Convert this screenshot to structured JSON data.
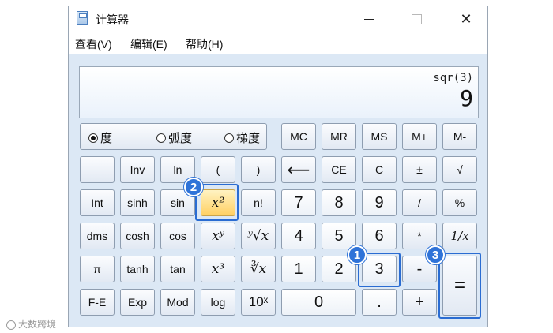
{
  "window": {
    "title": "计算器",
    "minimize": "—",
    "maximize": "□",
    "close": "✕"
  },
  "menu": [
    "查看(V)",
    "编辑(E)",
    "帮助(H)"
  ],
  "display": {
    "expression": "sqr(3)",
    "result": "9"
  },
  "angle_modes": {
    "selected": "度",
    "options": [
      "度",
      "弧度",
      "梯度"
    ]
  },
  "buttons": {
    "mc": "MC",
    "mr": "MR",
    "ms": "MS",
    "mplus": "M+",
    "mminus": "M-",
    "inv": "Inv",
    "ln": "ln",
    "lparen": "(",
    "rparen": ")",
    "backspace": "⟵",
    "ce": "CE",
    "c": "C",
    "plusminus": "±",
    "sqrt": "√",
    "int": "Int",
    "sinh": "sinh",
    "sin": "sin",
    "square": "x²",
    "factorial": "n!",
    "n7": "7",
    "n8": "8",
    "n9": "9",
    "divide": "/",
    "percent": "%",
    "dms": "dms",
    "cosh": "cosh",
    "cos": "cos",
    "pow": "xʸ",
    "yroot": "ʸ√x",
    "n4": "4",
    "n5": "5",
    "n6": "6",
    "multiply": "*",
    "reciprocal": "1/x",
    "pi": "π",
    "tanh": "tanh",
    "tan": "tan",
    "cube": "x³",
    "cuberoot": "∛x",
    "n1": "1",
    "n2": "2",
    "n3": "3",
    "minus": "-",
    "equals": "=",
    "fe": "F-E",
    "exp": "Exp",
    "mod": "Mod",
    "log": "log",
    "tenpow": "10ˣ",
    "n0": "0",
    "dot": ".",
    "plus": "+"
  },
  "markers": [
    "1",
    "2",
    "3"
  ],
  "watermark": "大数跨境",
  "accent_color": "#2f73d8"
}
